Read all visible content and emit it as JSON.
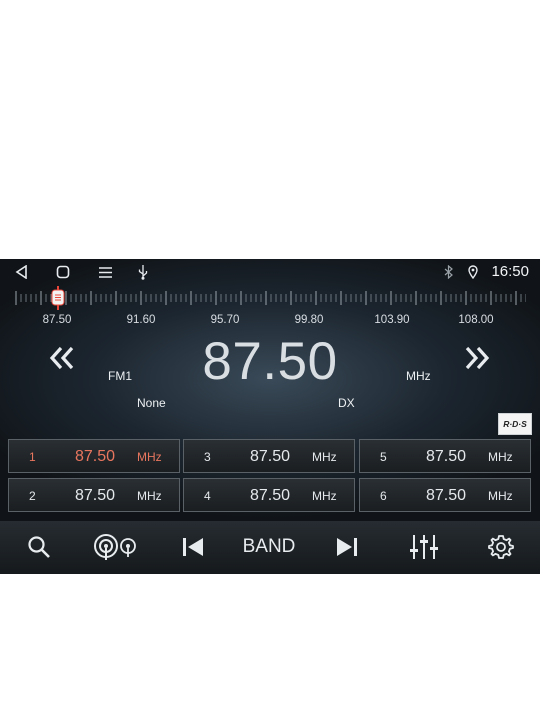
{
  "status_bar": {
    "time": "16:50"
  },
  "tuner": {
    "scale_labels": [
      "87.50",
      "91.60",
      "95.70",
      "99.80",
      "103.90",
      "108.00"
    ],
    "current_frequency": "87.50",
    "band": "FM1",
    "unit": "MHz",
    "pty": "None",
    "mode": "DX",
    "rds_badge": "R·D·S"
  },
  "presets": [
    {
      "number": "1",
      "frequency": "87.50",
      "unit": "MHz",
      "active": true
    },
    {
      "number": "2",
      "frequency": "87.50",
      "unit": "MHz",
      "active": false
    },
    {
      "number": "3",
      "frequency": "87.50",
      "unit": "MHz",
      "active": false
    },
    {
      "number": "4",
      "frequency": "87.50",
      "unit": "MHz",
      "active": false
    },
    {
      "number": "5",
      "frequency": "87.50",
      "unit": "MHz",
      "active": false
    },
    {
      "number": "6",
      "frequency": "87.50",
      "unit": "MHz",
      "active": false
    }
  ],
  "bottom_bar": {
    "band_label": "BAND"
  },
  "colors": {
    "active_preset": "#e8765f",
    "needle": "#e8453a"
  }
}
